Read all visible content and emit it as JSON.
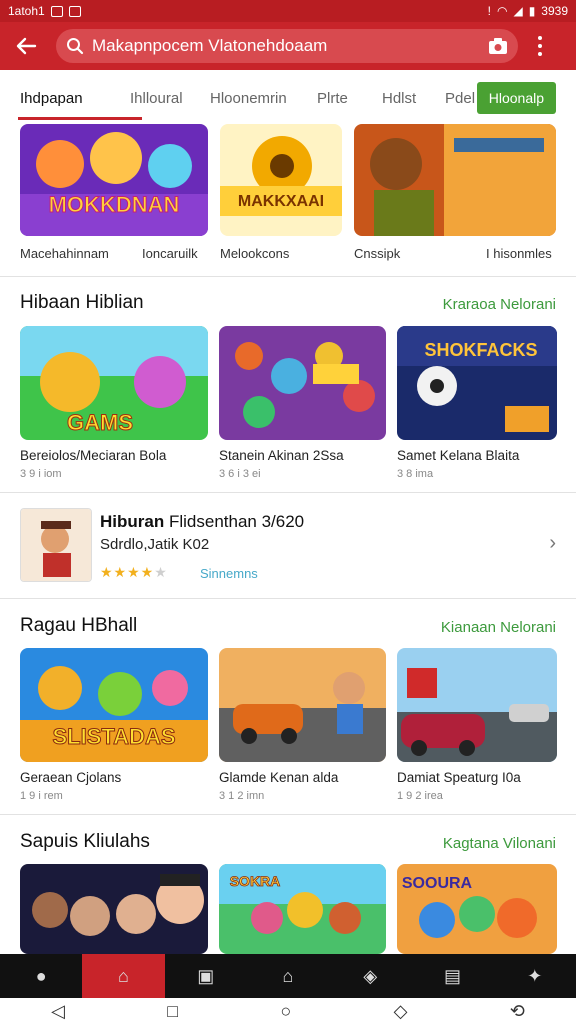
{
  "status": {
    "left_text": "1atoh1",
    "right_text": "3939"
  },
  "search": {
    "query": "Makapnpocem Vlatonehdoaam"
  },
  "tabs": [
    "Ihdpapan",
    "Ihlloural",
    "Hloonemrin",
    "Plrte",
    "Hdlst",
    "Pdel"
  ],
  "tab_button": "Hloonalp",
  "top_row": {
    "tiles": [
      {
        "text": "MOKKDNAN"
      },
      {
        "text": "MAKKXAAI"
      },
      {
        "text": ""
      }
    ],
    "labels": [
      "Macehahinnam",
      "Ioncaruilk",
      "Melookcons",
      "Cnssipk",
      "I hisonmles"
    ]
  },
  "section1": {
    "title": "Hibaan Hiblian",
    "link": "Kraraoa Nelorani",
    "cards": [
      {
        "title": "Bereiolos/Meciaran Bola",
        "sub": "3 9 i iom",
        "art_text": "GAMS"
      },
      {
        "title": "Stanein Akinan 2Ssa",
        "sub": "3 6 i 3 ei",
        "art_text": ""
      },
      {
        "title": "Samet Kelana Blaita",
        "sub": "3 8 ima",
        "art_text": "SHOKFACKS"
      }
    ]
  },
  "feature": {
    "title_bold": "Hiburan",
    "title_rest": "Flidsenthan 3/620",
    "sub": "Sdrdlo,Jatik K02",
    "stars_filled": 4,
    "stars_total": 5,
    "link": "Sinnemns"
  },
  "section2": {
    "title": "Ragau HBhall",
    "link": "Kianaan Nelorani",
    "cards": [
      {
        "title": "Geraean Cjolans",
        "sub": "1 9 i rem",
        "art_text": "SLISTADAS"
      },
      {
        "title": "Glamde Kenan alda",
        "sub": "3 1 2 imn",
        "art_text": ""
      },
      {
        "title": "Damiat Speaturg I0a",
        "sub": "1 9 2 irea",
        "art_text": ""
      }
    ]
  },
  "section3": {
    "title": "Sapuis Kliulahs",
    "link": "Kagtana Vilonani",
    "cards": [
      {
        "art_text": ""
      },
      {
        "art_text": "SOKRA"
      },
      {
        "art_text": "SOOURA"
      }
    ]
  },
  "colors": {
    "brand": "#c8242a",
    "green": "#4aa133",
    "link_green": "#3d9a3d"
  }
}
